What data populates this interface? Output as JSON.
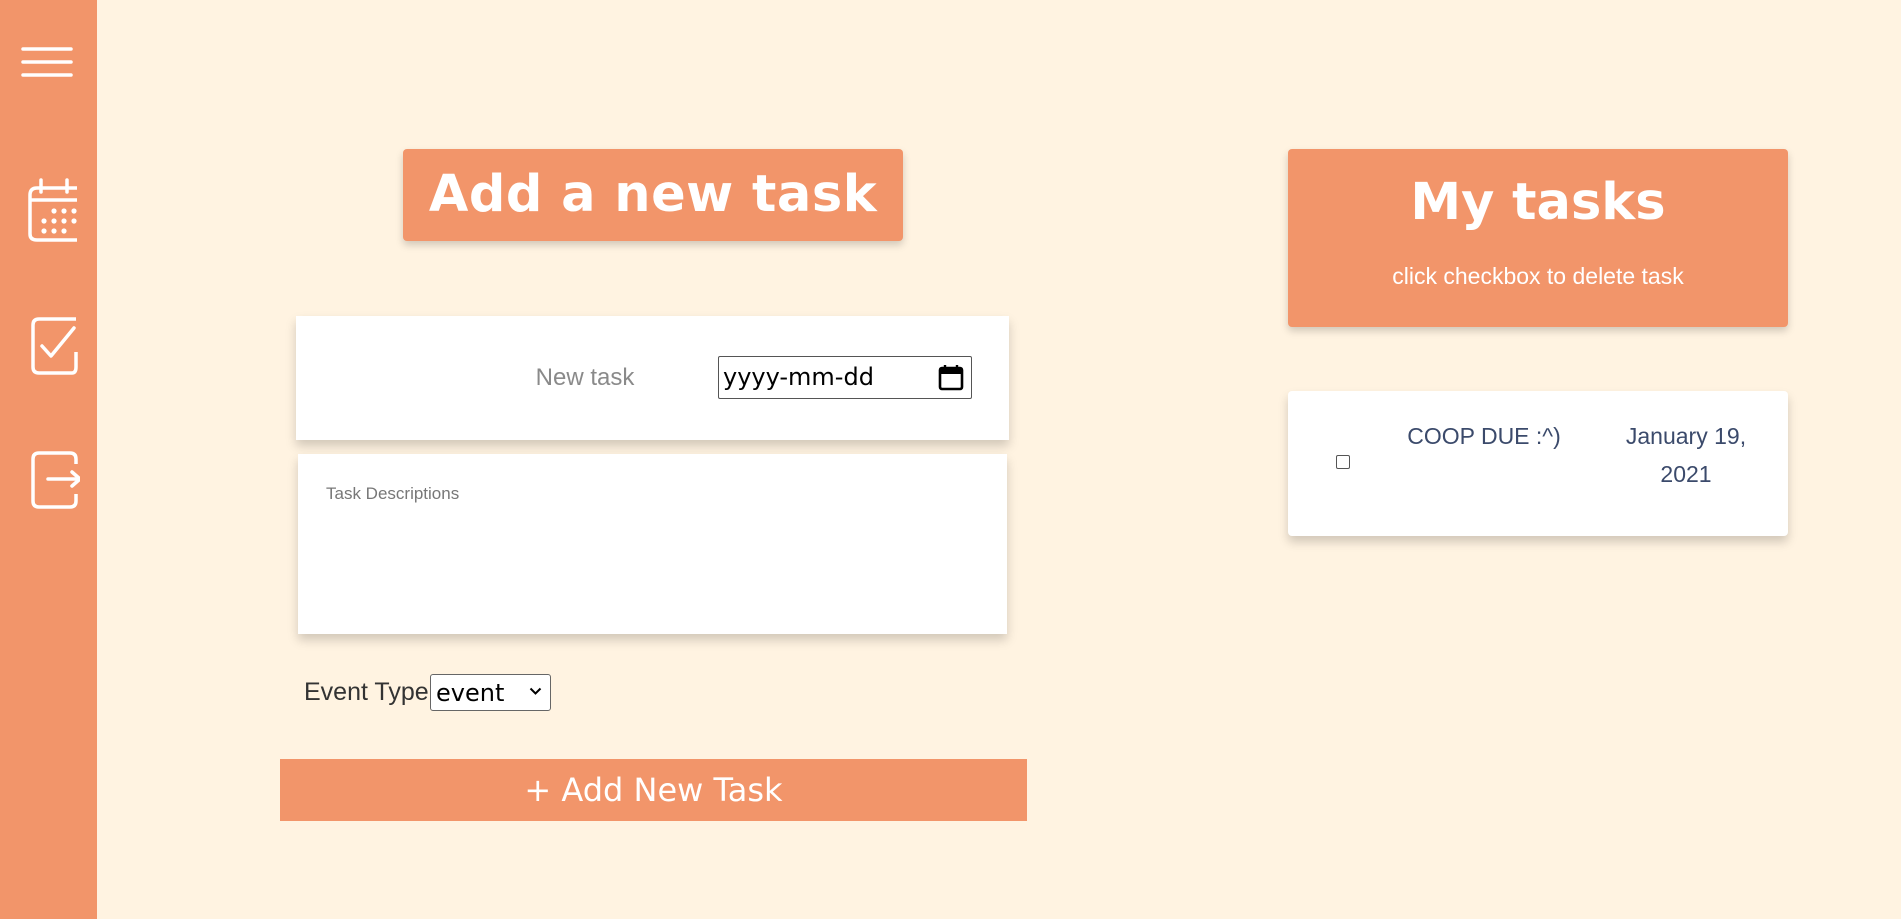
{
  "sidebar": {
    "items": [
      {
        "icon": "menu-icon"
      },
      {
        "icon": "calendar-icon"
      },
      {
        "icon": "checkbox-icon"
      },
      {
        "icon": "logout-icon"
      }
    ]
  },
  "add_task": {
    "title": "Add a new task",
    "task_placeholder": "New task",
    "date_placeholder": "yyyy-mm-dd",
    "description_placeholder": "Task Descriptions",
    "event_type_label": "Event Type:",
    "event_type_value": "event",
    "add_button_label": "+ Add New Task"
  },
  "my_tasks": {
    "title": "My tasks",
    "subtitle": "click checkbox to delete task",
    "items": [
      {
        "title": "COOP DUE :^)",
        "date": "January 19, 2021"
      }
    ]
  },
  "colors": {
    "accent": "#f2956a",
    "background": "#fff3e1",
    "panel": "#ffffff",
    "task_text": "#3b4a6b"
  }
}
